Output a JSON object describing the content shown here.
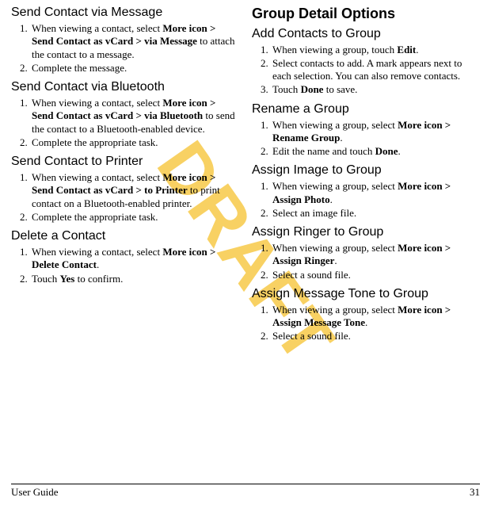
{
  "watermark": "DRAFT",
  "left": {
    "sec1": {
      "title": "Send Contact via Message",
      "steps": [
        {
          "pre": "When viewing a contact, select ",
          "bold": "More icon > Send Contact as vCard > via Message",
          "post": " to attach the contact to a message."
        },
        {
          "pre": "Complete the message.",
          "bold": "",
          "post": ""
        }
      ]
    },
    "sec2": {
      "title": "Send Contact via Bluetooth",
      "steps": [
        {
          "pre": "When viewing a contact, select ",
          "bold": "More icon > Send Contact as vCard > via Bluetooth",
          "post": " to send the contact to a Bluetooth-enabled device."
        },
        {
          "pre": "Complete the appropriate task.",
          "bold": "",
          "post": ""
        }
      ]
    },
    "sec3": {
      "title": "Send Contact to Printer",
      "steps": [
        {
          "pre": "When viewing a contact, select ",
          "bold": "More icon > Send Contact as vCard > to Printer",
          "post": " to print contact on a Bluetooth-enabled printer."
        },
        {
          "pre": "Complete the appropriate task.",
          "bold": "",
          "post": ""
        }
      ]
    },
    "sec4": {
      "title": "Delete a Contact",
      "steps": [
        {
          "pre": "When viewing a contact, select ",
          "bold": "More icon > Delete Contact",
          "post": "."
        },
        {
          "pre": "Touch ",
          "bold": "Yes",
          "post": " to confirm."
        }
      ]
    }
  },
  "right": {
    "majorTitle": "Group Detail Options",
    "sec1": {
      "title": "Add Contacts to Group",
      "steps": [
        {
          "pre": "When viewing a group, touch ",
          "bold": "Edit",
          "post": "."
        },
        {
          "pre": "Select contacts to add. A mark appears next to each selection. You can also remove contacts.",
          "bold": "",
          "post": ""
        },
        {
          "pre": "Touch ",
          "bold": "Done",
          "post": " to save."
        }
      ]
    },
    "sec2": {
      "title": "Rename a Group",
      "steps": [
        {
          "pre": "When viewing a group, select ",
          "bold": "More icon > Rename Group",
          "post": "."
        },
        {
          "pre": "Edit the name and touch ",
          "bold": "Done",
          "post": "."
        }
      ]
    },
    "sec3": {
      "title": "Assign Image to Group",
      "steps": [
        {
          "pre": "When viewing a group, select ",
          "bold": "More icon > Assign Photo",
          "post": "."
        },
        {
          "pre": "Select an image file.",
          "bold": "",
          "post": ""
        }
      ]
    },
    "sec4": {
      "title": "Assign Ringer to Group",
      "steps": [
        {
          "pre": "When viewing a group, select ",
          "bold": "More icon > Assign Ringer",
          "post": "."
        },
        {
          "pre": "Select a sound file.",
          "bold": "",
          "post": ""
        }
      ]
    },
    "sec5": {
      "title": "Assign Message Tone to Group",
      "steps": [
        {
          "pre": "When viewing a group, select ",
          "bold": "More icon > Assign Message Tone",
          "post": "."
        },
        {
          "pre": "Select a sound file.",
          "bold": "",
          "post": ""
        }
      ]
    }
  },
  "footer": {
    "left": "User Guide",
    "right": "31"
  }
}
